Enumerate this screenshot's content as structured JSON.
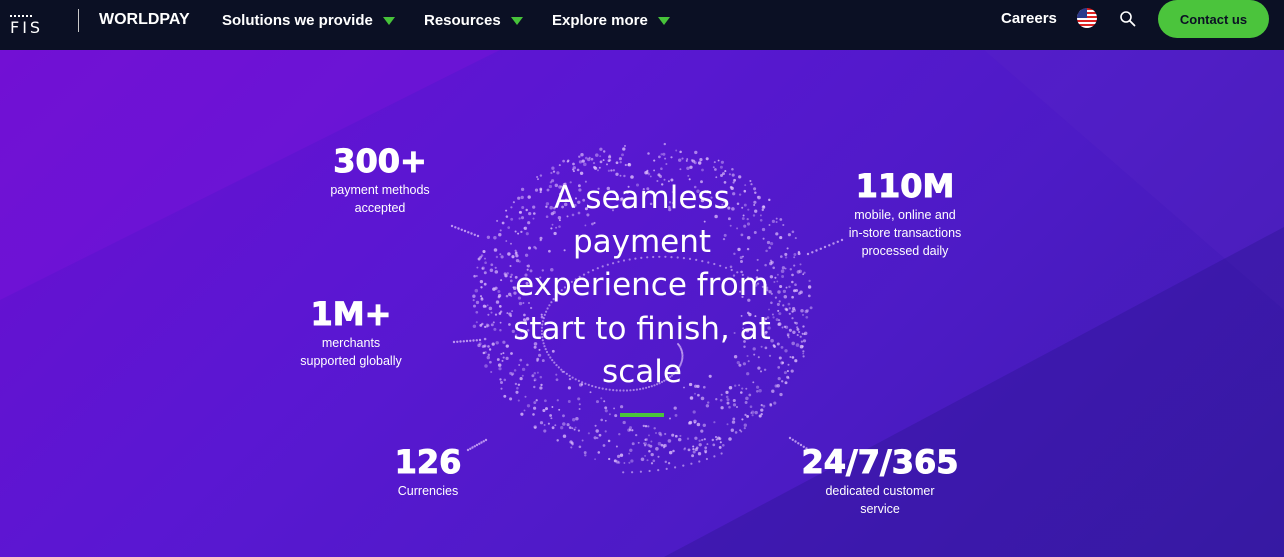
{
  "header": {
    "brand_logo_text": "FIS",
    "brand_name": "WORLDPAY",
    "nav": [
      {
        "label": "Solutions we provide"
      },
      {
        "label": "Resources"
      },
      {
        "label": "Explore more"
      }
    ],
    "careers_label": "Careers",
    "contact_label": "Contact us",
    "accent_color": "#4bc43c"
  },
  "hero": {
    "headline": "A seamless payment experience from start to finish, at scale",
    "stats": [
      {
        "value": "300+",
        "label_line1": "payment methods",
        "label_line2": "accepted"
      },
      {
        "value": "110M",
        "label_line1": "mobile, online and",
        "label_line2": "in-store transactions",
        "label_line3": "processed daily"
      },
      {
        "value": "1M+",
        "label_line1": "merchants",
        "label_line2": "supported globally"
      },
      {
        "value": "126",
        "label_line1": "Currencies"
      },
      {
        "value": "24/7/365",
        "label_line1": "dedicated customer",
        "label_line2": "service"
      }
    ]
  },
  "icons": {
    "flag": "us-flag-icon",
    "search": "search-icon",
    "caret": "chevron-down-icon"
  }
}
